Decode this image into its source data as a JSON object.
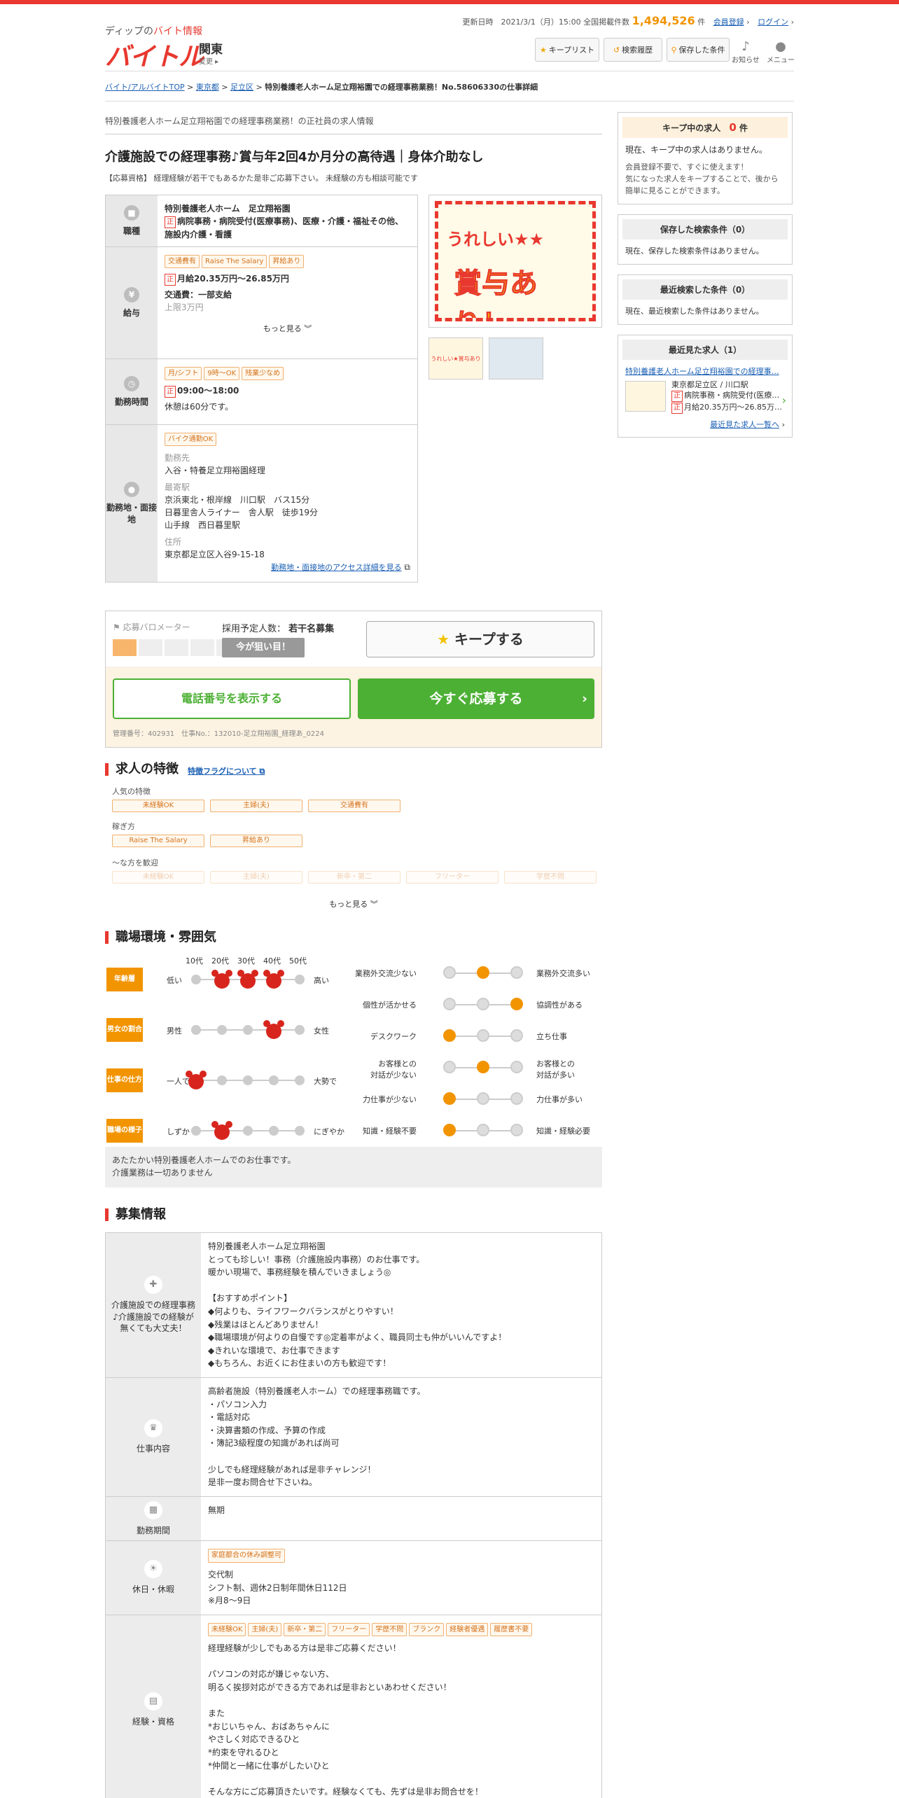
{
  "header": {
    "sub_prefix": "ディップの",
    "sub_brand": "バイト情報",
    "logo": "バイトル",
    "region": "関東",
    "region_change": "変更",
    "update_label": "更新日時　2021/3/1（月）15:00 全国掲載件数",
    "total_count": "1,494,526",
    "count_unit": "件",
    "register": "会員登録",
    "login": "ログイン",
    "keep_list": "キープリスト",
    "search_history": "検索履歴",
    "saved_conditions": "保存した条件",
    "notice": "お知らせ",
    "menu": "メニュー"
  },
  "breadcrumb": {
    "top": "バイト/アルバイトTOP",
    "pref": "東京都",
    "city": "足立区",
    "current": "特別養護老人ホーム足立翔裕園での経理事務業務！No.58606330の仕事詳細"
  },
  "job": {
    "subheading": "特別養護老人ホーム足立翔裕園での経理事務業務！の正社員の求人情報",
    "title": "介護施設での経理事務♪賞与年2回4か月分の高待遇｜身体介助なし",
    "qualification": "【応募資格】 経理経験が若干でもあるかた是非ご応募下さい。 未経験の方も相談可能です",
    "type_label": "職種",
    "company": "特別養護老人ホーム　足立翔裕園",
    "zen": "正",
    "type_value": "病院事務・病院受付(医療事務)、医療・介護・福祉その他、施設内介護・看護",
    "salary_label": "給与",
    "salary_tags": [
      "交通費有",
      "Raise The Salary",
      "昇給あり"
    ],
    "salary": "月給20.35万円～26.85万円",
    "transport": "交通費：一部支給",
    "transport_limit": "上限3万円",
    "more": "もっと見る",
    "hours_label": "勤務時間",
    "hours_tags": [
      "月/シフト",
      "9時～OK",
      "残業少なめ"
    ],
    "hours": "09:00～18:00",
    "break": "休憩は60分です。",
    "place_label": "勤務地・面接地",
    "place_tags": [
      "バイク通勤OK"
    ],
    "workplace_h": "勤務先",
    "workplace": "入谷・特養足立翔裕園経理",
    "station_h": "最寄駅",
    "station1": "京浜東北・根岸線　川口駅　バス15分",
    "station2": "日暮里舎人ライナー　舎人駅　徒歩19分",
    "station3": "山手線　西日暮里駅",
    "address_h": "住所",
    "address": "東京都足立区入谷9-15-18",
    "access_link": "勤務地・面接地のアクセス詳細を見る",
    "photo_t1": "うれしい★★",
    "photo_t2": "賞与あり！",
    "thumb1": "うれしい★賞与あり",
    "thumb2": ""
  },
  "apply": {
    "meter": "応募バロメーター",
    "hires_label": "採用予定人数：",
    "hires": "若干名募集",
    "chance": "今が狙い目！",
    "keep": "キープする",
    "phone": "電話番号を表示する",
    "apply_now": "今すぐ応募する",
    "mgmt": "管理番号：402931　仕事No.：132010-足立翔裕園_経理あ_0224",
    "meter_level": 1
  },
  "features": {
    "heading": "求人の特徴",
    "flag_link": "特徴フラグについて",
    "popular_h": "人気の特徴",
    "popular": [
      "未経験OK",
      "主婦(夫)",
      "交通費有"
    ],
    "earn_h": "稼ぎ方",
    "earn": [
      "Raise The Salary",
      "昇給あり"
    ],
    "welcome_h": "～な方を歓迎",
    "welcome": [
      "未経験OK",
      "主婦(夫)",
      "新卒・第二",
      "フリーター",
      "学歴不問"
    ],
    "more": "もっと見る"
  },
  "env": {
    "heading": "職場環境・雰囲気",
    "age_ticks": [
      "10代",
      "20代",
      "30代",
      "40代",
      "50代"
    ],
    "rows": [
      {
        "label": "年齢層",
        "left": "低い",
        "right": "高い",
        "marks": [
          1,
          2,
          3
        ]
      },
      {
        "label": "男女の割合",
        "left": "男性",
        "right": "女性",
        "marks": [
          3
        ]
      },
      {
        "label": "仕事の仕方",
        "left": "一人で",
        "right": "大勢で",
        "marks": [
          0
        ]
      },
      {
        "label": "職場の様子",
        "left": "しずか",
        "right": "にぎやか",
        "marks": [
          1
        ]
      }
    ],
    "scales": [
      {
        "left": "業務外交流少ない",
        "right": "業務外交流多い",
        "level": 1
      },
      {
        "left": "個性が活かせる",
        "right": "協調性がある",
        "level": 2
      },
      {
        "left": "デスクワーク",
        "right": "立ち仕事",
        "level": 0
      },
      {
        "left": "お客様との\n対話が少ない",
        "right": "お客様との\n対話が多い",
        "level": 1
      },
      {
        "left": "力仕事が少ない",
        "right": "力仕事が多い",
        "level": 0
      },
      {
        "left": "知識・経験不要",
        "right": "知識・経験必要",
        "level": 0
      }
    ],
    "note1": "あたたかい特別養護老人ホームでのお仕事です。",
    "note2": "介護業務は一切ありません"
  },
  "recruit": {
    "heading": "募集情報",
    "rows": [
      {
        "label": "介護施設での経理事務♪介護施設での経験が無くても大丈夫！",
        "icon": "✚",
        "body": "特別養護老人ホーム足立翔裕園\nとっても珍しい！事務（介護施設内事務）のお仕事です。\n暖かい現場で、事務経験を積んでいきましょう◎\n\n【おすすめポイント】\n◆何よりも、ライフワークバランスがとりやすい！\n◆残業はほとんどありません！\n◆職場環境が何よりの自慢です◎定着率がよく、職員同士も仲がいいんですよ！\n◆きれいな環境で、お仕事できます\n◆もちろん、お近くにお住まいの方も歓迎です！"
      },
      {
        "label": "仕事内容",
        "icon": "♛",
        "body": "高齢者施設（特別養護老人ホーム）での経理事務職です。\n・パソコン入力\n・電話対応\n・決算書類の作成、予算の作成\n・簿記3級程度の知識があれば尚可\n\n少しでも経理経験があれば是非チャレンジ！\n是非一度お問合せ下さいね。"
      },
      {
        "label": "勤務期間",
        "icon": "▦",
        "body": "無期"
      },
      {
        "label": "休日・休暇",
        "icon": "☀",
        "tags": [
          "家庭都合の休み調整可"
        ],
        "body": "交代制\nシフト制、週休2日制年間休日112日\n※月8～9日"
      },
      {
        "label": "経験・資格",
        "icon": "▤",
        "tags": [
          "未経験OK",
          "主婦(夫)",
          "新卒・第二",
          "フリーター",
          "学歴不問",
          "ブランク",
          "経験者優遇",
          "履歴書不要"
        ],
        "body": "経理経験が少しでもある方は是非ご応募ください！\n\nパソコンの対応が嫌じゃない方、\n明るく挨拶対応ができる方であれば是非おといあわせください！\n\nまた\n*おじいちゃん、おばあちゃんに\nやさしく対応できるひと\n*約束を守れるひと\n*仲間と一緒に仕事がしたいひと\n\nそんな方にご応募頂きたいです。経験なくても、先ずは是非お問合せを！"
      }
    ]
  },
  "sidebar": {
    "keep_h": "キープ中の求人",
    "keep_count": "0",
    "keep_unit": "件",
    "keep_body1": "現在、キープ中の求人はありません。",
    "keep_body2": "会員登録不要で、すぐに使えます！\n気になった求人をキープすることで、後から簡単に見ることができます。",
    "saved_h": "保存した検索条件（0）",
    "saved_body": "現在、保存した検索条件はありません。",
    "recent_search_h": "最近検索した条件（0）",
    "recent_search_body": "現在、最近検索した条件はありません。",
    "viewed_h": "最近見た求人（1）",
    "viewed_title": "特別養護老人ホーム足立翔裕園での経理事…",
    "viewed_loc": "東京都足立区 / 川口駅",
    "viewed_type": "病院事務・病院受付(医療…",
    "viewed_salary": "月給20.35万円～26.85万…",
    "viewed_zen": "正",
    "viewed_all": "最近見た求人一覧へ"
  },
  "colors": {
    "brand": "#e8382f",
    "accent": "#f29400",
    "green": "#4cb034"
  }
}
